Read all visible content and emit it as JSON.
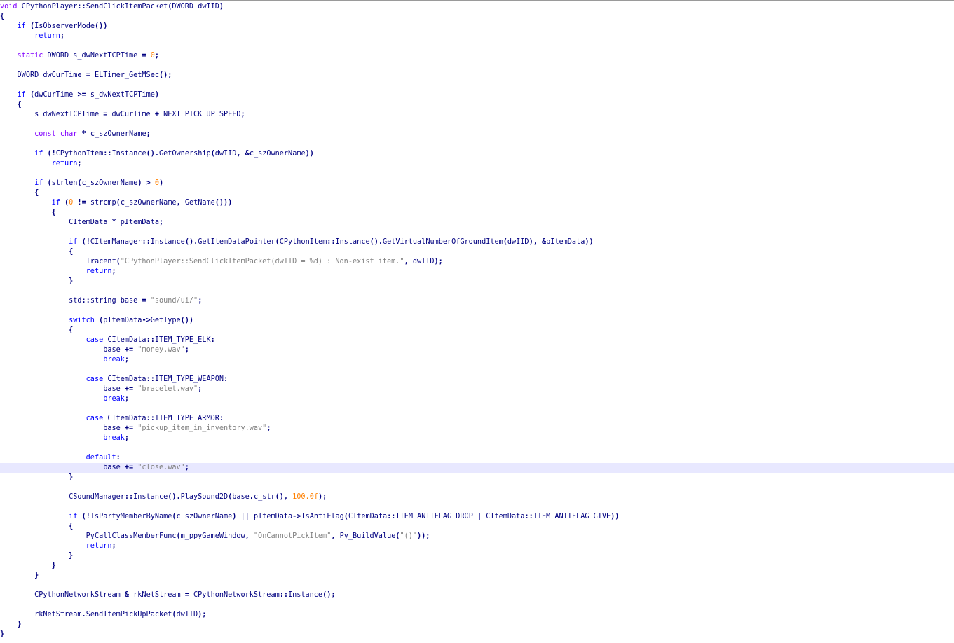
{
  "editor": {
    "current_line_index": 47,
    "colors": {
      "keyword": "#0000ff",
      "type_keyword": "#8000ff",
      "string": "#808080",
      "number": "#ff8000",
      "default": "#000080",
      "operator": "#000080",
      "current_line_bg": "#e8e8ff",
      "top_border": "#9a9a9a"
    },
    "lines": [
      [
        [
          "kw2",
          "void"
        ],
        [
          "id",
          " CPythonPlayer"
        ],
        [
          "op",
          "::"
        ],
        [
          "id",
          "SendClickItemPacket"
        ],
        [
          "op",
          "("
        ],
        [
          "id",
          "DWORD dwIID"
        ],
        [
          "op",
          ")"
        ]
      ],
      [
        [
          "op",
          "{"
        ]
      ],
      [
        [
          "sp",
          "    "
        ],
        [
          "kw1",
          "if"
        ],
        [
          "id",
          " "
        ],
        [
          "op",
          "("
        ],
        [
          "id",
          "IsObserverMode"
        ],
        [
          "op",
          "())"
        ]
      ],
      [
        [
          "sp",
          "        "
        ],
        [
          "kw1",
          "return"
        ],
        [
          "op",
          ";"
        ]
      ],
      [],
      [
        [
          "sp",
          "    "
        ],
        [
          "kw2",
          "static"
        ],
        [
          "id",
          " DWORD s_dwNextTCPTime "
        ],
        [
          "op",
          "="
        ],
        [
          "id",
          " "
        ],
        [
          "num",
          "0"
        ],
        [
          "op",
          ";"
        ]
      ],
      [],
      [
        [
          "sp",
          "    "
        ],
        [
          "id",
          "DWORD dwCurTime "
        ],
        [
          "op",
          "="
        ],
        [
          "id",
          " ELTimer_GetMSec"
        ],
        [
          "op",
          "();"
        ]
      ],
      [],
      [
        [
          "sp",
          "    "
        ],
        [
          "kw1",
          "if"
        ],
        [
          "id",
          " "
        ],
        [
          "op",
          "("
        ],
        [
          "id",
          "dwCurTime "
        ],
        [
          "op",
          ">="
        ],
        [
          "id",
          " s_dwNextTCPTime"
        ],
        [
          "op",
          ")"
        ]
      ],
      [
        [
          "sp",
          "    "
        ],
        [
          "op",
          "{"
        ]
      ],
      [
        [
          "sp",
          "        "
        ],
        [
          "id",
          "s_dwNextTCPTime "
        ],
        [
          "op",
          "="
        ],
        [
          "id",
          " dwCurTime "
        ],
        [
          "op",
          "+"
        ],
        [
          "id",
          " NEXT_PICK_UP_SPEED"
        ],
        [
          "op",
          ";"
        ]
      ],
      [],
      [
        [
          "sp",
          "        "
        ],
        [
          "kw2",
          "const"
        ],
        [
          "id",
          " "
        ],
        [
          "kw2",
          "char"
        ],
        [
          "id",
          " "
        ],
        [
          "op",
          "*"
        ],
        [
          "id",
          " c_szOwnerName"
        ],
        [
          "op",
          ";"
        ]
      ],
      [],
      [
        [
          "sp",
          "        "
        ],
        [
          "kw1",
          "if"
        ],
        [
          "id",
          " "
        ],
        [
          "op",
          "(!"
        ],
        [
          "id",
          "CPythonItem"
        ],
        [
          "op",
          "::"
        ],
        [
          "id",
          "Instance"
        ],
        [
          "op",
          "()."
        ],
        [
          "id",
          "GetOwnership"
        ],
        [
          "op",
          "("
        ],
        [
          "id",
          "dwIID"
        ],
        [
          "op",
          ","
        ],
        [
          "id",
          " "
        ],
        [
          "op",
          "&"
        ],
        [
          "id",
          "c_szOwnerName"
        ],
        [
          "op",
          "))"
        ]
      ],
      [
        [
          "sp",
          "            "
        ],
        [
          "kw1",
          "return"
        ],
        [
          "op",
          ";"
        ]
      ],
      [],
      [
        [
          "sp",
          "        "
        ],
        [
          "kw1",
          "if"
        ],
        [
          "id",
          " "
        ],
        [
          "op",
          "("
        ],
        [
          "id",
          "strlen"
        ],
        [
          "op",
          "("
        ],
        [
          "id",
          "c_szOwnerName"
        ],
        [
          "op",
          ")"
        ],
        [
          "id",
          " "
        ],
        [
          "op",
          ">"
        ],
        [
          "id",
          " "
        ],
        [
          "num",
          "0"
        ],
        [
          "op",
          ")"
        ]
      ],
      [
        [
          "sp",
          "        "
        ],
        [
          "op",
          "{"
        ]
      ],
      [
        [
          "sp",
          "            "
        ],
        [
          "kw1",
          "if"
        ],
        [
          "id",
          " "
        ],
        [
          "op",
          "("
        ],
        [
          "num",
          "0"
        ],
        [
          "id",
          " "
        ],
        [
          "op",
          "!="
        ],
        [
          "id",
          " strcmp"
        ],
        [
          "op",
          "("
        ],
        [
          "id",
          "c_szOwnerName"
        ],
        [
          "op",
          ","
        ],
        [
          "id",
          " GetName"
        ],
        [
          "op",
          "()))"
        ]
      ],
      [
        [
          "sp",
          "            "
        ],
        [
          "op",
          "{"
        ]
      ],
      [
        [
          "sp",
          "                "
        ],
        [
          "id",
          "CItemData "
        ],
        [
          "op",
          "*"
        ],
        [
          "id",
          " pItemData"
        ],
        [
          "op",
          ";"
        ]
      ],
      [],
      [
        [
          "sp",
          "                "
        ],
        [
          "kw1",
          "if"
        ],
        [
          "id",
          " "
        ],
        [
          "op",
          "(!"
        ],
        [
          "id",
          "CItemManager"
        ],
        [
          "op",
          "::"
        ],
        [
          "id",
          "Instance"
        ],
        [
          "op",
          "()."
        ],
        [
          "id",
          "GetItemDataPointer"
        ],
        [
          "op",
          "("
        ],
        [
          "id",
          "CPythonItem"
        ],
        [
          "op",
          "::"
        ],
        [
          "id",
          "Instance"
        ],
        [
          "op",
          "()."
        ],
        [
          "id",
          "GetVirtualNumberOfGroundItem"
        ],
        [
          "op",
          "("
        ],
        [
          "id",
          "dwIID"
        ],
        [
          "op",
          "),"
        ],
        [
          "id",
          " "
        ],
        [
          "op",
          "&"
        ],
        [
          "id",
          "pItemData"
        ],
        [
          "op",
          "))"
        ]
      ],
      [
        [
          "sp",
          "                "
        ],
        [
          "op",
          "{"
        ]
      ],
      [
        [
          "sp",
          "                    "
        ],
        [
          "id",
          "Tracenf"
        ],
        [
          "op",
          "("
        ],
        [
          "str",
          "\"CPythonPlayer::SendClickItemPacket(dwIID = %d) : Non-exist item.\""
        ],
        [
          "op",
          ","
        ],
        [
          "id",
          " dwIID"
        ],
        [
          "op",
          ");"
        ]
      ],
      [
        [
          "sp",
          "                    "
        ],
        [
          "kw1",
          "return"
        ],
        [
          "op",
          ";"
        ]
      ],
      [
        [
          "sp",
          "                "
        ],
        [
          "op",
          "}"
        ]
      ],
      [],
      [
        [
          "sp",
          "                "
        ],
        [
          "id",
          "std"
        ],
        [
          "op",
          "::"
        ],
        [
          "id",
          "string base "
        ],
        [
          "op",
          "="
        ],
        [
          "id",
          " "
        ],
        [
          "str",
          "\"sound/ui/\""
        ],
        [
          "op",
          ";"
        ]
      ],
      [],
      [
        [
          "sp",
          "                "
        ],
        [
          "kw1",
          "switch"
        ],
        [
          "id",
          " "
        ],
        [
          "op",
          "("
        ],
        [
          "id",
          "pItemData"
        ],
        [
          "op",
          "->"
        ],
        [
          "id",
          "GetType"
        ],
        [
          "op",
          "())"
        ]
      ],
      [
        [
          "sp",
          "                "
        ],
        [
          "op",
          "{"
        ]
      ],
      [
        [
          "sp",
          "                    "
        ],
        [
          "kw1",
          "case"
        ],
        [
          "id",
          " CItemData"
        ],
        [
          "op",
          "::"
        ],
        [
          "id",
          "ITEM_TYPE_ELK"
        ],
        [
          "op",
          ":"
        ]
      ],
      [
        [
          "sp",
          "                        "
        ],
        [
          "id",
          "base "
        ],
        [
          "op",
          "+="
        ],
        [
          "id",
          " "
        ],
        [
          "str",
          "\"money.wav\""
        ],
        [
          "op",
          ";"
        ]
      ],
      [
        [
          "sp",
          "                        "
        ],
        [
          "kw1",
          "break"
        ],
        [
          "op",
          ";"
        ]
      ],
      [],
      [
        [
          "sp",
          "                    "
        ],
        [
          "kw1",
          "case"
        ],
        [
          "id",
          " CItemData"
        ],
        [
          "op",
          "::"
        ],
        [
          "id",
          "ITEM_TYPE_WEAPON"
        ],
        [
          "op",
          ":"
        ]
      ],
      [
        [
          "sp",
          "                        "
        ],
        [
          "id",
          "base "
        ],
        [
          "op",
          "+="
        ],
        [
          "id",
          " "
        ],
        [
          "str",
          "\"bracelet.wav\""
        ],
        [
          "op",
          ";"
        ]
      ],
      [
        [
          "sp",
          "                        "
        ],
        [
          "kw1",
          "break"
        ],
        [
          "op",
          ";"
        ]
      ],
      [],
      [
        [
          "sp",
          "                    "
        ],
        [
          "kw1",
          "case"
        ],
        [
          "id",
          " CItemData"
        ],
        [
          "op",
          "::"
        ],
        [
          "id",
          "ITEM_TYPE_ARMOR"
        ],
        [
          "op",
          ":"
        ]
      ],
      [
        [
          "sp",
          "                        "
        ],
        [
          "id",
          "base "
        ],
        [
          "op",
          "+="
        ],
        [
          "id",
          " "
        ],
        [
          "str",
          "\"pickup_item_in_inventory.wav\""
        ],
        [
          "op",
          ";"
        ]
      ],
      [
        [
          "sp",
          "                        "
        ],
        [
          "kw1",
          "break"
        ],
        [
          "op",
          ";"
        ]
      ],
      [],
      [
        [
          "sp",
          "                    "
        ],
        [
          "kw1",
          "default"
        ],
        [
          "op",
          ":"
        ]
      ],
      [
        [
          "sp",
          "                        "
        ],
        [
          "id",
          "base "
        ],
        [
          "op",
          "+="
        ],
        [
          "id",
          " "
        ],
        [
          "str",
          "\"close.wav\""
        ],
        [
          "op",
          ";"
        ]
      ],
      [
        [
          "sp",
          "                "
        ],
        [
          "op",
          "}"
        ]
      ],
      [],
      [
        [
          "sp",
          "                "
        ],
        [
          "id",
          "CSoundManager"
        ],
        [
          "op",
          "::"
        ],
        [
          "id",
          "Instance"
        ],
        [
          "op",
          "()."
        ],
        [
          "id",
          "PlaySound2D"
        ],
        [
          "op",
          "("
        ],
        [
          "id",
          "base"
        ],
        [
          "op",
          "."
        ],
        [
          "id",
          "c_str"
        ],
        [
          "op",
          "(),"
        ],
        [
          "id",
          " "
        ],
        [
          "num",
          "100.0f"
        ],
        [
          "op",
          ");"
        ]
      ],
      [],
      [
        [
          "sp",
          "                "
        ],
        [
          "kw1",
          "if"
        ],
        [
          "id",
          " "
        ],
        [
          "op",
          "(!"
        ],
        [
          "id",
          "IsPartyMemberByName"
        ],
        [
          "op",
          "("
        ],
        [
          "id",
          "c_szOwnerName"
        ],
        [
          "op",
          ")"
        ],
        [
          "id",
          " "
        ],
        [
          "op",
          "||"
        ],
        [
          "id",
          " pItemData"
        ],
        [
          "op",
          "->"
        ],
        [
          "id",
          "IsAntiFlag"
        ],
        [
          "op",
          "("
        ],
        [
          "id",
          "CItemData"
        ],
        [
          "op",
          "::"
        ],
        [
          "id",
          "ITEM_ANTIFLAG_DROP "
        ],
        [
          "op",
          "|"
        ],
        [
          "id",
          " CItemData"
        ],
        [
          "op",
          "::"
        ],
        [
          "id",
          "ITEM_ANTIFLAG_GIVE"
        ],
        [
          "op",
          "))"
        ]
      ],
      [
        [
          "sp",
          "                "
        ],
        [
          "op",
          "{"
        ]
      ],
      [
        [
          "sp",
          "                    "
        ],
        [
          "id",
          "PyCallClassMemberFunc"
        ],
        [
          "op",
          "("
        ],
        [
          "id",
          "m_ppyGameWindow"
        ],
        [
          "op",
          ","
        ],
        [
          "id",
          " "
        ],
        [
          "str",
          "\"OnCannotPickItem\""
        ],
        [
          "op",
          ","
        ],
        [
          "id",
          " Py_BuildValue"
        ],
        [
          "op",
          "("
        ],
        [
          "str",
          "\"()\""
        ],
        [
          "op",
          "));"
        ]
      ],
      [
        [
          "sp",
          "                    "
        ],
        [
          "kw1",
          "return"
        ],
        [
          "op",
          ";"
        ]
      ],
      [
        [
          "sp",
          "                "
        ],
        [
          "op",
          "}"
        ]
      ],
      [
        [
          "sp",
          "            "
        ],
        [
          "op",
          "}"
        ]
      ],
      [
        [
          "sp",
          "        "
        ],
        [
          "op",
          "}"
        ]
      ],
      [],
      [
        [
          "sp",
          "        "
        ],
        [
          "id",
          "CPythonNetworkStream "
        ],
        [
          "op",
          "&"
        ],
        [
          "id",
          " rkNetStream "
        ],
        [
          "op",
          "="
        ],
        [
          "id",
          " CPythonNetworkStream"
        ],
        [
          "op",
          "::"
        ],
        [
          "id",
          "Instance"
        ],
        [
          "op",
          "();"
        ]
      ],
      [],
      [
        [
          "sp",
          "        "
        ],
        [
          "id",
          "rkNetStream"
        ],
        [
          "op",
          "."
        ],
        [
          "id",
          "SendItemPickUpPacket"
        ],
        [
          "op",
          "("
        ],
        [
          "id",
          "dwIID"
        ],
        [
          "op",
          ");"
        ]
      ],
      [
        [
          "sp",
          "    "
        ],
        [
          "op",
          "}"
        ]
      ],
      [
        [
          "op",
          "}"
        ]
      ]
    ]
  }
}
